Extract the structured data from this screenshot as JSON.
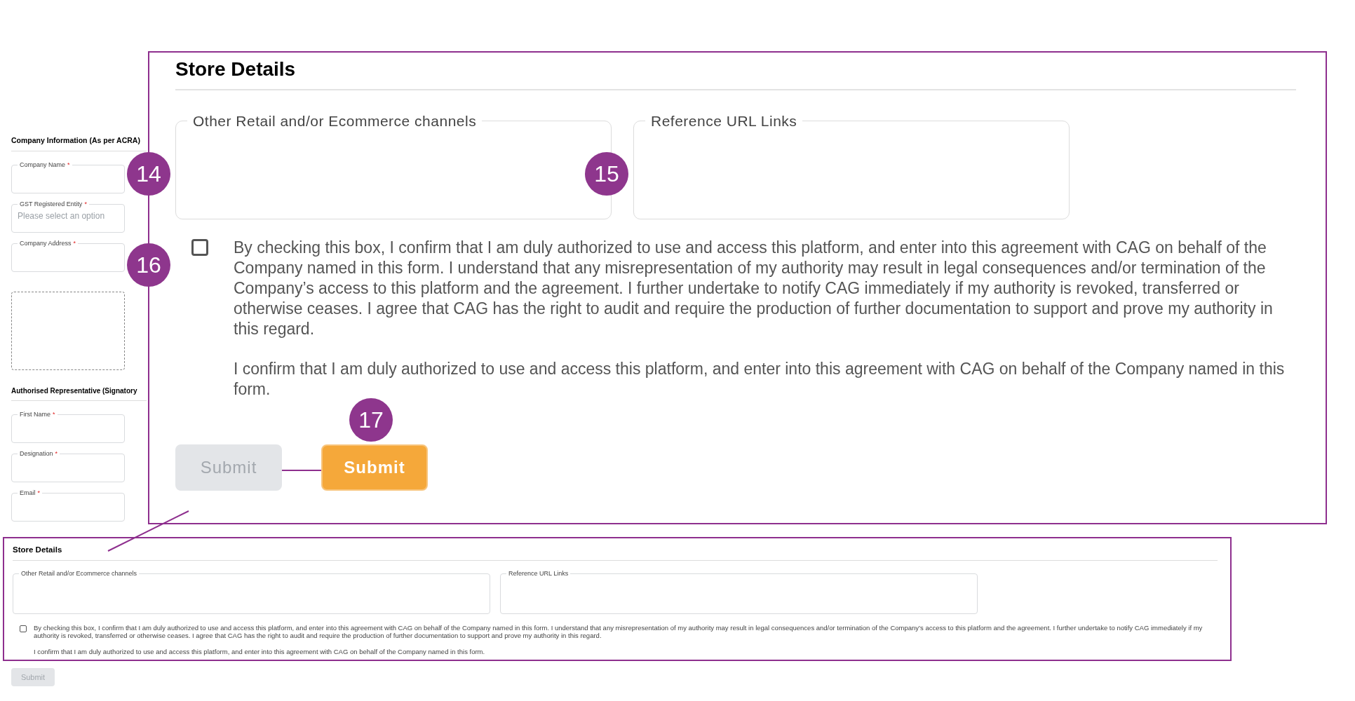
{
  "company_information": {
    "title": "Company Information (As per ACRA)",
    "fields": [
      {
        "label": "Company Name",
        "required_mark": "*"
      },
      {
        "label": "GST Registered Entity",
        "required_mark": "*",
        "placeholder": "Please select an option"
      },
      {
        "label": "Company Address",
        "required_mark": "*"
      }
    ]
  },
  "authorised_representative": {
    "title": "Authorised Representative (Signatory",
    "fields": [
      {
        "label": "First Name",
        "required_mark": "*"
      },
      {
        "label": "Designation",
        "required_mark": "*"
      },
      {
        "label": "Email",
        "required_mark": "*"
      }
    ]
  },
  "store_details": {
    "title": "Store Details",
    "fields": [
      {
        "label": "Other Retail and/or Ecommerce channels"
      },
      {
        "label": "Reference URL Links"
      }
    ],
    "consent": {
      "checked": false,
      "text": "By checking this box, I confirm that I am duly authorized to use and access this platform, and enter into this agreement with CAG on behalf of the Company named in this form. I understand that any misrepresentation of my authority may result in legal consequences and/or termination of the Company’s access to this platform and the agreement. I further undertake to notify CAG immediately if my authority is revoked, transferred or otherwise ceases. I agree that CAG has the right to audit and require the production of further documentation to support and prove my authority in this regard.",
      "confirmation": "I confirm that I am duly authorized to use and access this platform, and enter into this agreement with CAG on behalf of the Company named in this form."
    },
    "submit": {
      "label": "Submit",
      "disabled": true
    }
  },
  "callout": {
    "title": "Store Details",
    "fields": [
      {
        "label": "Other Retail and/or Ecommerce channels"
      },
      {
        "label": "Reference URL Links"
      }
    ],
    "consent": {
      "checked": false,
      "text": "By checking this box, I confirm that I am duly authorized to use and access this platform, and enter into this agreement with CAG on behalf of the Company named in this form. I understand that any misrepresentation of my authority may result in legal consequences and/or termination of the Company’s access to this platform and the agreement. I further undertake to notify CAG immediately if my authority is revoked, transferred or otherwise ceases. I agree that CAG has the right to audit and require the production of further documentation to support and prove my authority in this regard.",
      "confirmation": "I confirm that I am duly authorized to use and access this platform, and enter into this agreement with CAG on behalf of the Company named in this form."
    },
    "buttons": [
      {
        "label": "Submit",
        "disabled": true
      },
      {
        "label": "Submit",
        "disabled": false
      }
    ]
  },
  "markers": [
    "14",
    "15",
    "16",
    "17"
  ]
}
